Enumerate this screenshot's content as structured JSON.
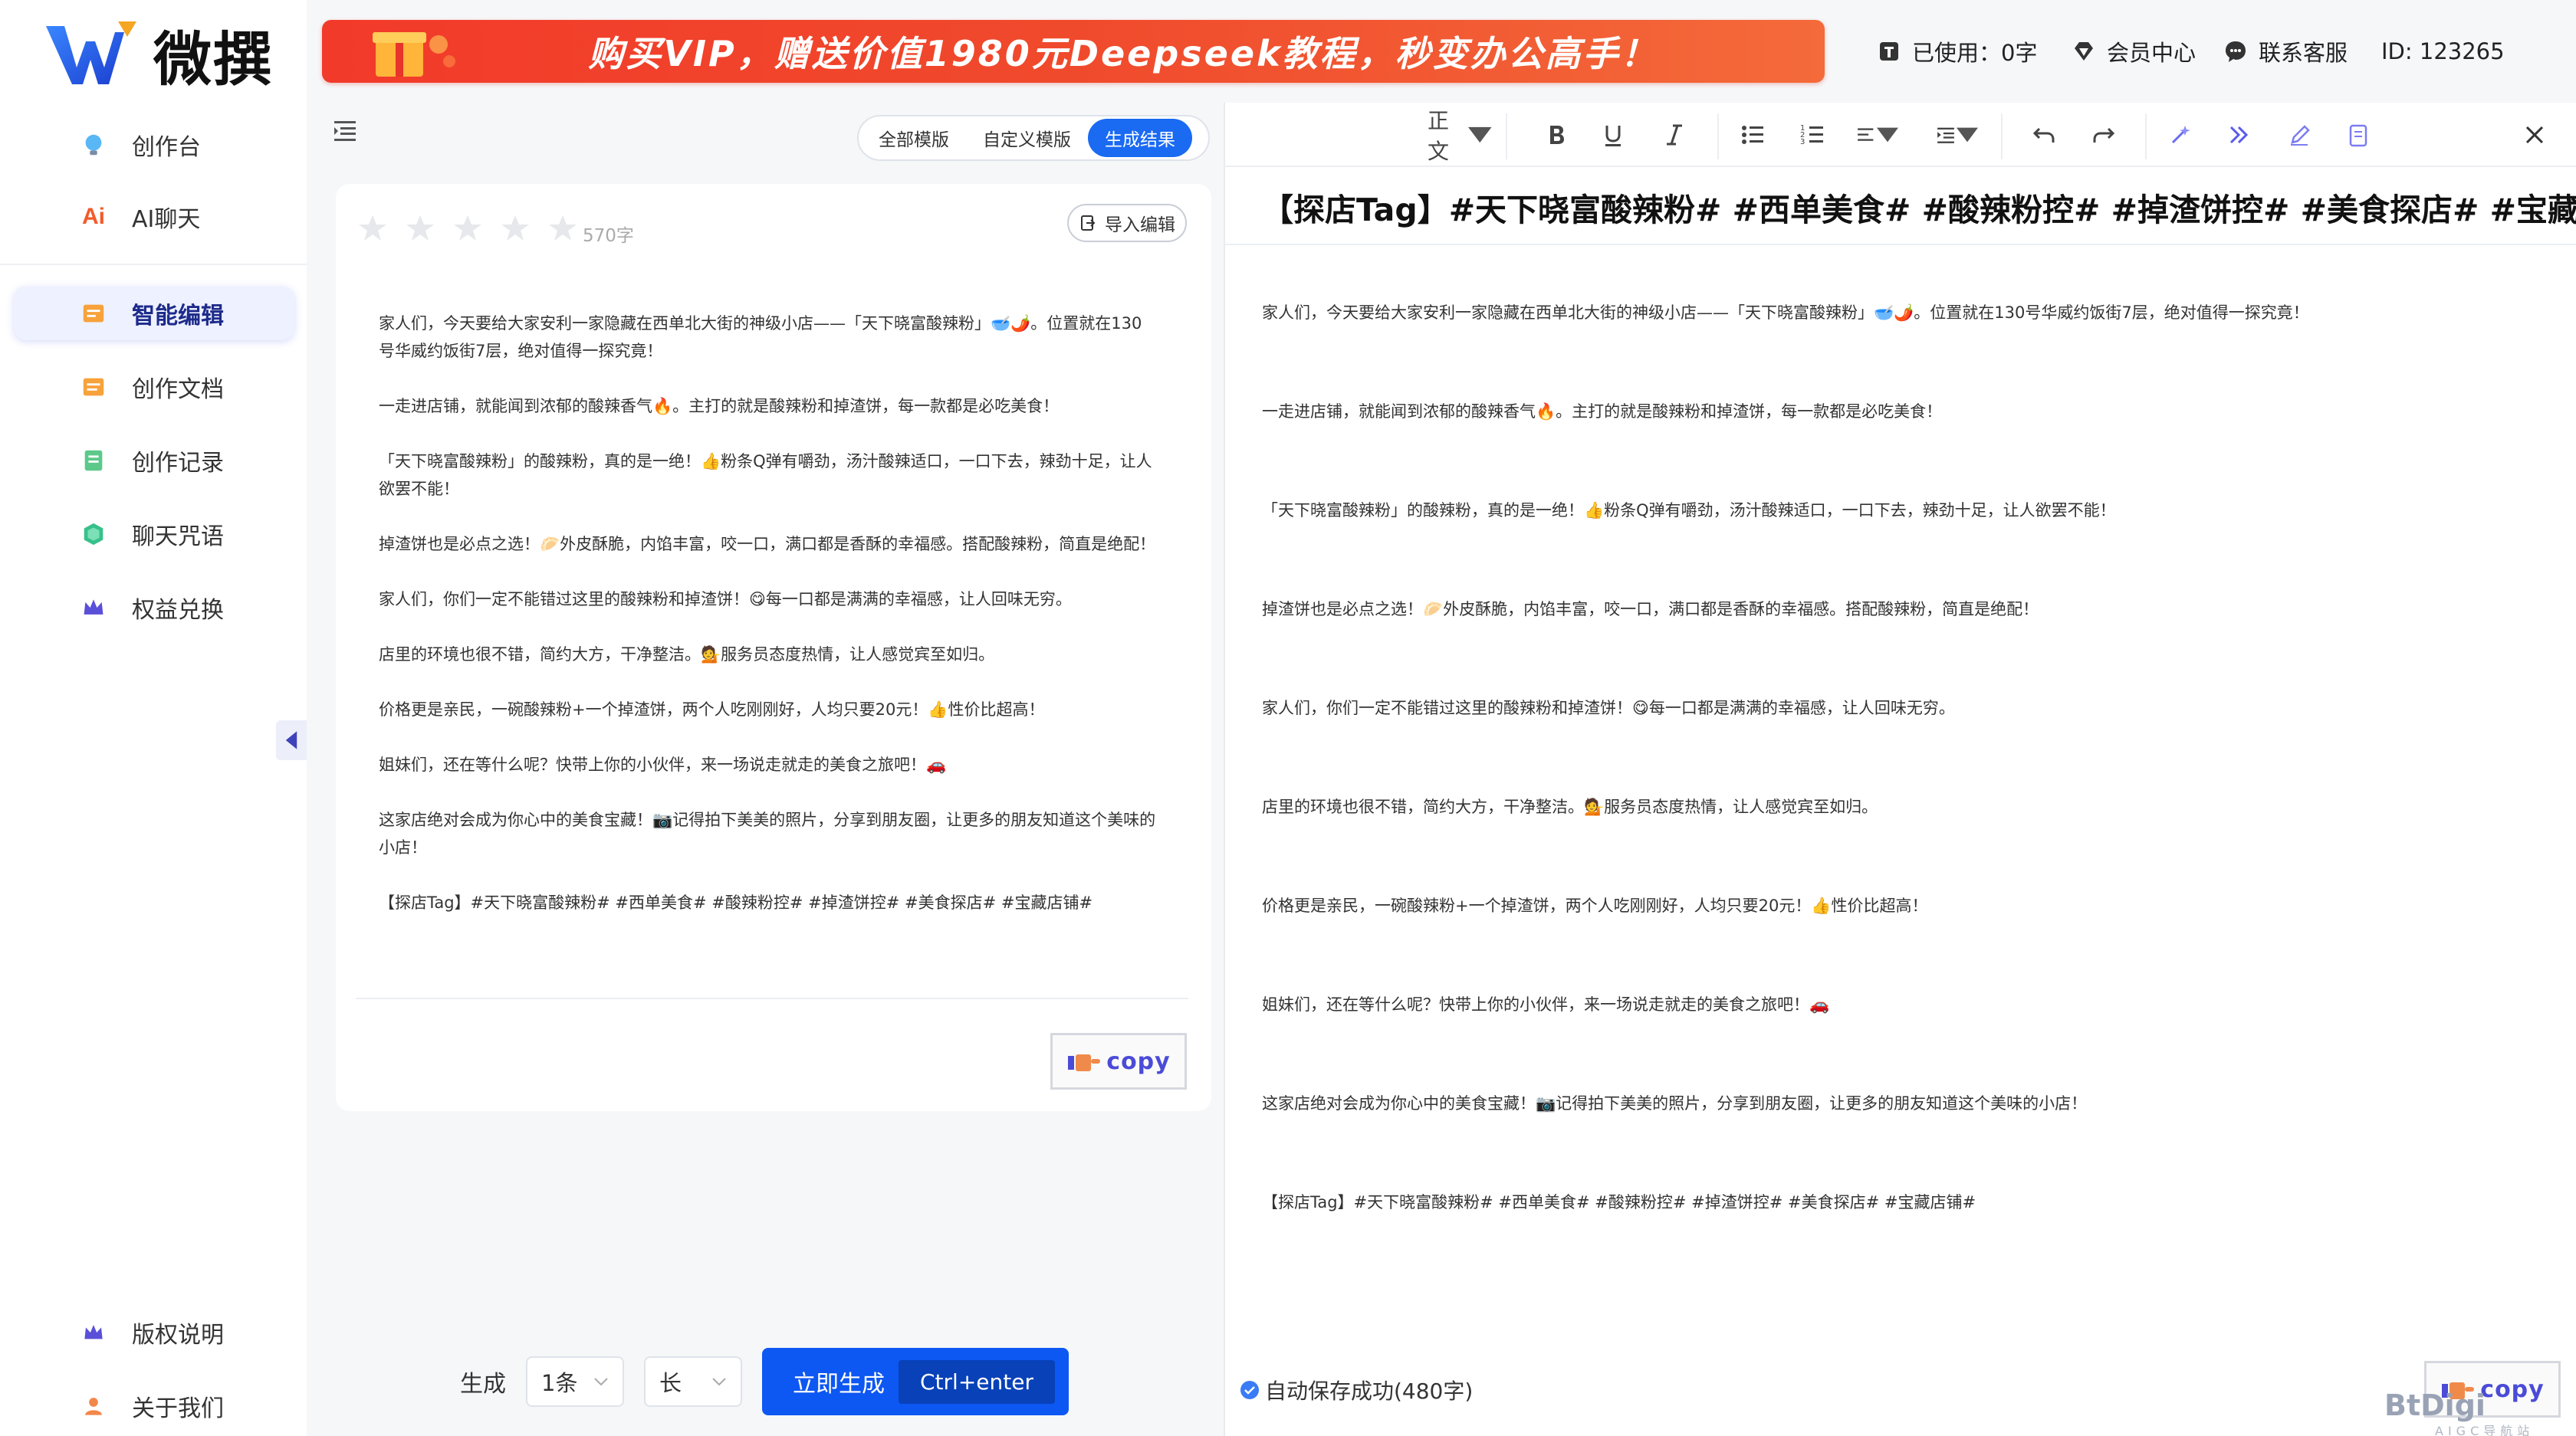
{
  "brand": {
    "name": "微撰"
  },
  "banner": {
    "text": "购买VIP，赠送价值1980元Deepseek教程，秒变办公高手！"
  },
  "topbar": {
    "usage": "已使用：0字",
    "member_center": "会员中心",
    "contact": "联系客服",
    "user_id": "ID: 123265"
  },
  "sidebar": {
    "items": [
      {
        "label": "创作台",
        "icon": "bulb-icon"
      },
      {
        "label": "AI聊天",
        "icon": "ai-chat-icon"
      },
      {
        "label": "智能编辑",
        "icon": "smart-edit-icon",
        "active": true
      },
      {
        "label": "创作文档",
        "icon": "document-icon"
      },
      {
        "label": "创作记录",
        "icon": "record-icon"
      },
      {
        "label": "聊天咒语",
        "icon": "spell-icon"
      },
      {
        "label": "权益兑换",
        "icon": "crown-icon"
      }
    ],
    "bottom": [
      {
        "label": "版权说明",
        "icon": "crown-icon"
      },
      {
        "label": "关于我们",
        "icon": "user-icon"
      }
    ],
    "ai_prefix": "Ai",
    "chat_label": "AI聊天"
  },
  "tabs": [
    {
      "label": "全部模版"
    },
    {
      "label": "自定义模版"
    },
    {
      "label": "生成结果",
      "active": true
    }
  ],
  "result": {
    "rating": 0,
    "word_count": "570字",
    "import_label": "导入编辑",
    "paragraphs": [
      "家人们，今天要给大家安利一家隐藏在西单北大街的神级小店——「天下晓富酸辣粉」🥣🌶️。位置就在130号华威约饭街7层，绝对值得一探究竟！",
      "一走进店铺，就能闻到浓郁的酸辣香气🔥。主打的就是酸辣粉和掉渣饼，每一款都是必吃美食！",
      "「天下晓富酸辣粉」的酸辣粉，真的是一绝！👍粉条Q弹有嚼劲，汤汁酸辣适口，一口下去，辣劲十足，让人欲罢不能！",
      "掉渣饼也是必点之选！🥟外皮酥脆，内馅丰富，咬一口，满口都是香酥的幸福感。搭配酸辣粉，简直是绝配！",
      "家人们，你们一定不能错过这里的酸辣粉和掉渣饼！😋每一口都是满满的幸福感，让人回味无穷。",
      "店里的环境也很不错，简约大方，干净整洁。💁服务员态度热情，让人感觉宾至如归。",
      "价格更是亲民，一碗酸辣粉+一个掉渣饼，两个人吃刚刚好，人均只要20元！👍性价比超高！",
      "姐妹们，还在等什么呢？快带上你的小伙伴，来一场说走就走的美食之旅吧！🚗",
      "这家店绝对会成为你心中的美食宝藏！📷记得拍下美美的照片，分享到朋友圈，让更多的朋友知道这个美味的小店！",
      "【探店Tag】#天下晓富酸辣粉# #西单美食# #酸辣粉控# #掉渣饼控# #美食探店# #宝藏店铺#"
    ],
    "copy_label": "copy"
  },
  "generate": {
    "label": "生成",
    "count": "1条",
    "length": "长",
    "button": "立即生成",
    "shortcut": "Ctrl+enter"
  },
  "editor": {
    "paragraph_style": "正文",
    "title": "【探店Tag】#天下晓富酸辣粉# #西单美食# #酸辣粉控# #掉渣饼控# #美食探店# #宝藏店铺#",
    "paragraphs": [
      "家人们，今天要给大家安利一家隐藏在西单北大街的神级小店——「天下晓富酸辣粉」🥣🌶️。位置就在130号华威约饭街7层，绝对值得一探究竟！",
      "一走进店铺，就能闻到浓郁的酸辣香气🔥。主打的就是酸辣粉和掉渣饼，每一款都是必吃美食！",
      "「天下晓富酸辣粉」的酸辣粉，真的是一绝！👍粉条Q弹有嚼劲，汤汁酸辣适口，一口下去，辣劲十足，让人欲罢不能！",
      "掉渣饼也是必点之选！🥟外皮酥脆，内馅丰富，咬一口，满口都是香酥的幸福感。搭配酸辣粉，简直是绝配！",
      "家人们，你们一定不能错过这里的酸辣粉和掉渣饼！😋每一口都是满满的幸福感，让人回味无穷。",
      "店里的环境也很不错，简约大方，干净整洁。💁服务员态度热情，让人感觉宾至如归。",
      "价格更是亲民，一碗酸辣粉+一个掉渣饼，两个人吃刚刚好，人均只要20元！👍性价比超高！",
      "姐妹们，还在等什么呢？快带上你的小伙伴，来一场说走就走的美食之旅吧！🚗",
      "这家店绝对会成为你心中的美食宝藏！📷记得拍下美美的照片，分享到朋友圈，让更多的朋友知道这个美味的小店！",
      "【探店Tag】#天下晓富酸辣粉# #西单美食# #酸辣粉控# #掉渣饼控# #美食探店# #宝藏店铺#"
    ],
    "autosave": "自动保存成功(480字)",
    "copy_label": "copy"
  },
  "watermark": {
    "text": "BtDigi",
    "sub": "AIGC导航站"
  },
  "colors": {
    "primary": "#0d57f2",
    "banner": "#f23a2a",
    "active_nav": "#eef1ff",
    "copy_text": "#4b4bd8"
  }
}
